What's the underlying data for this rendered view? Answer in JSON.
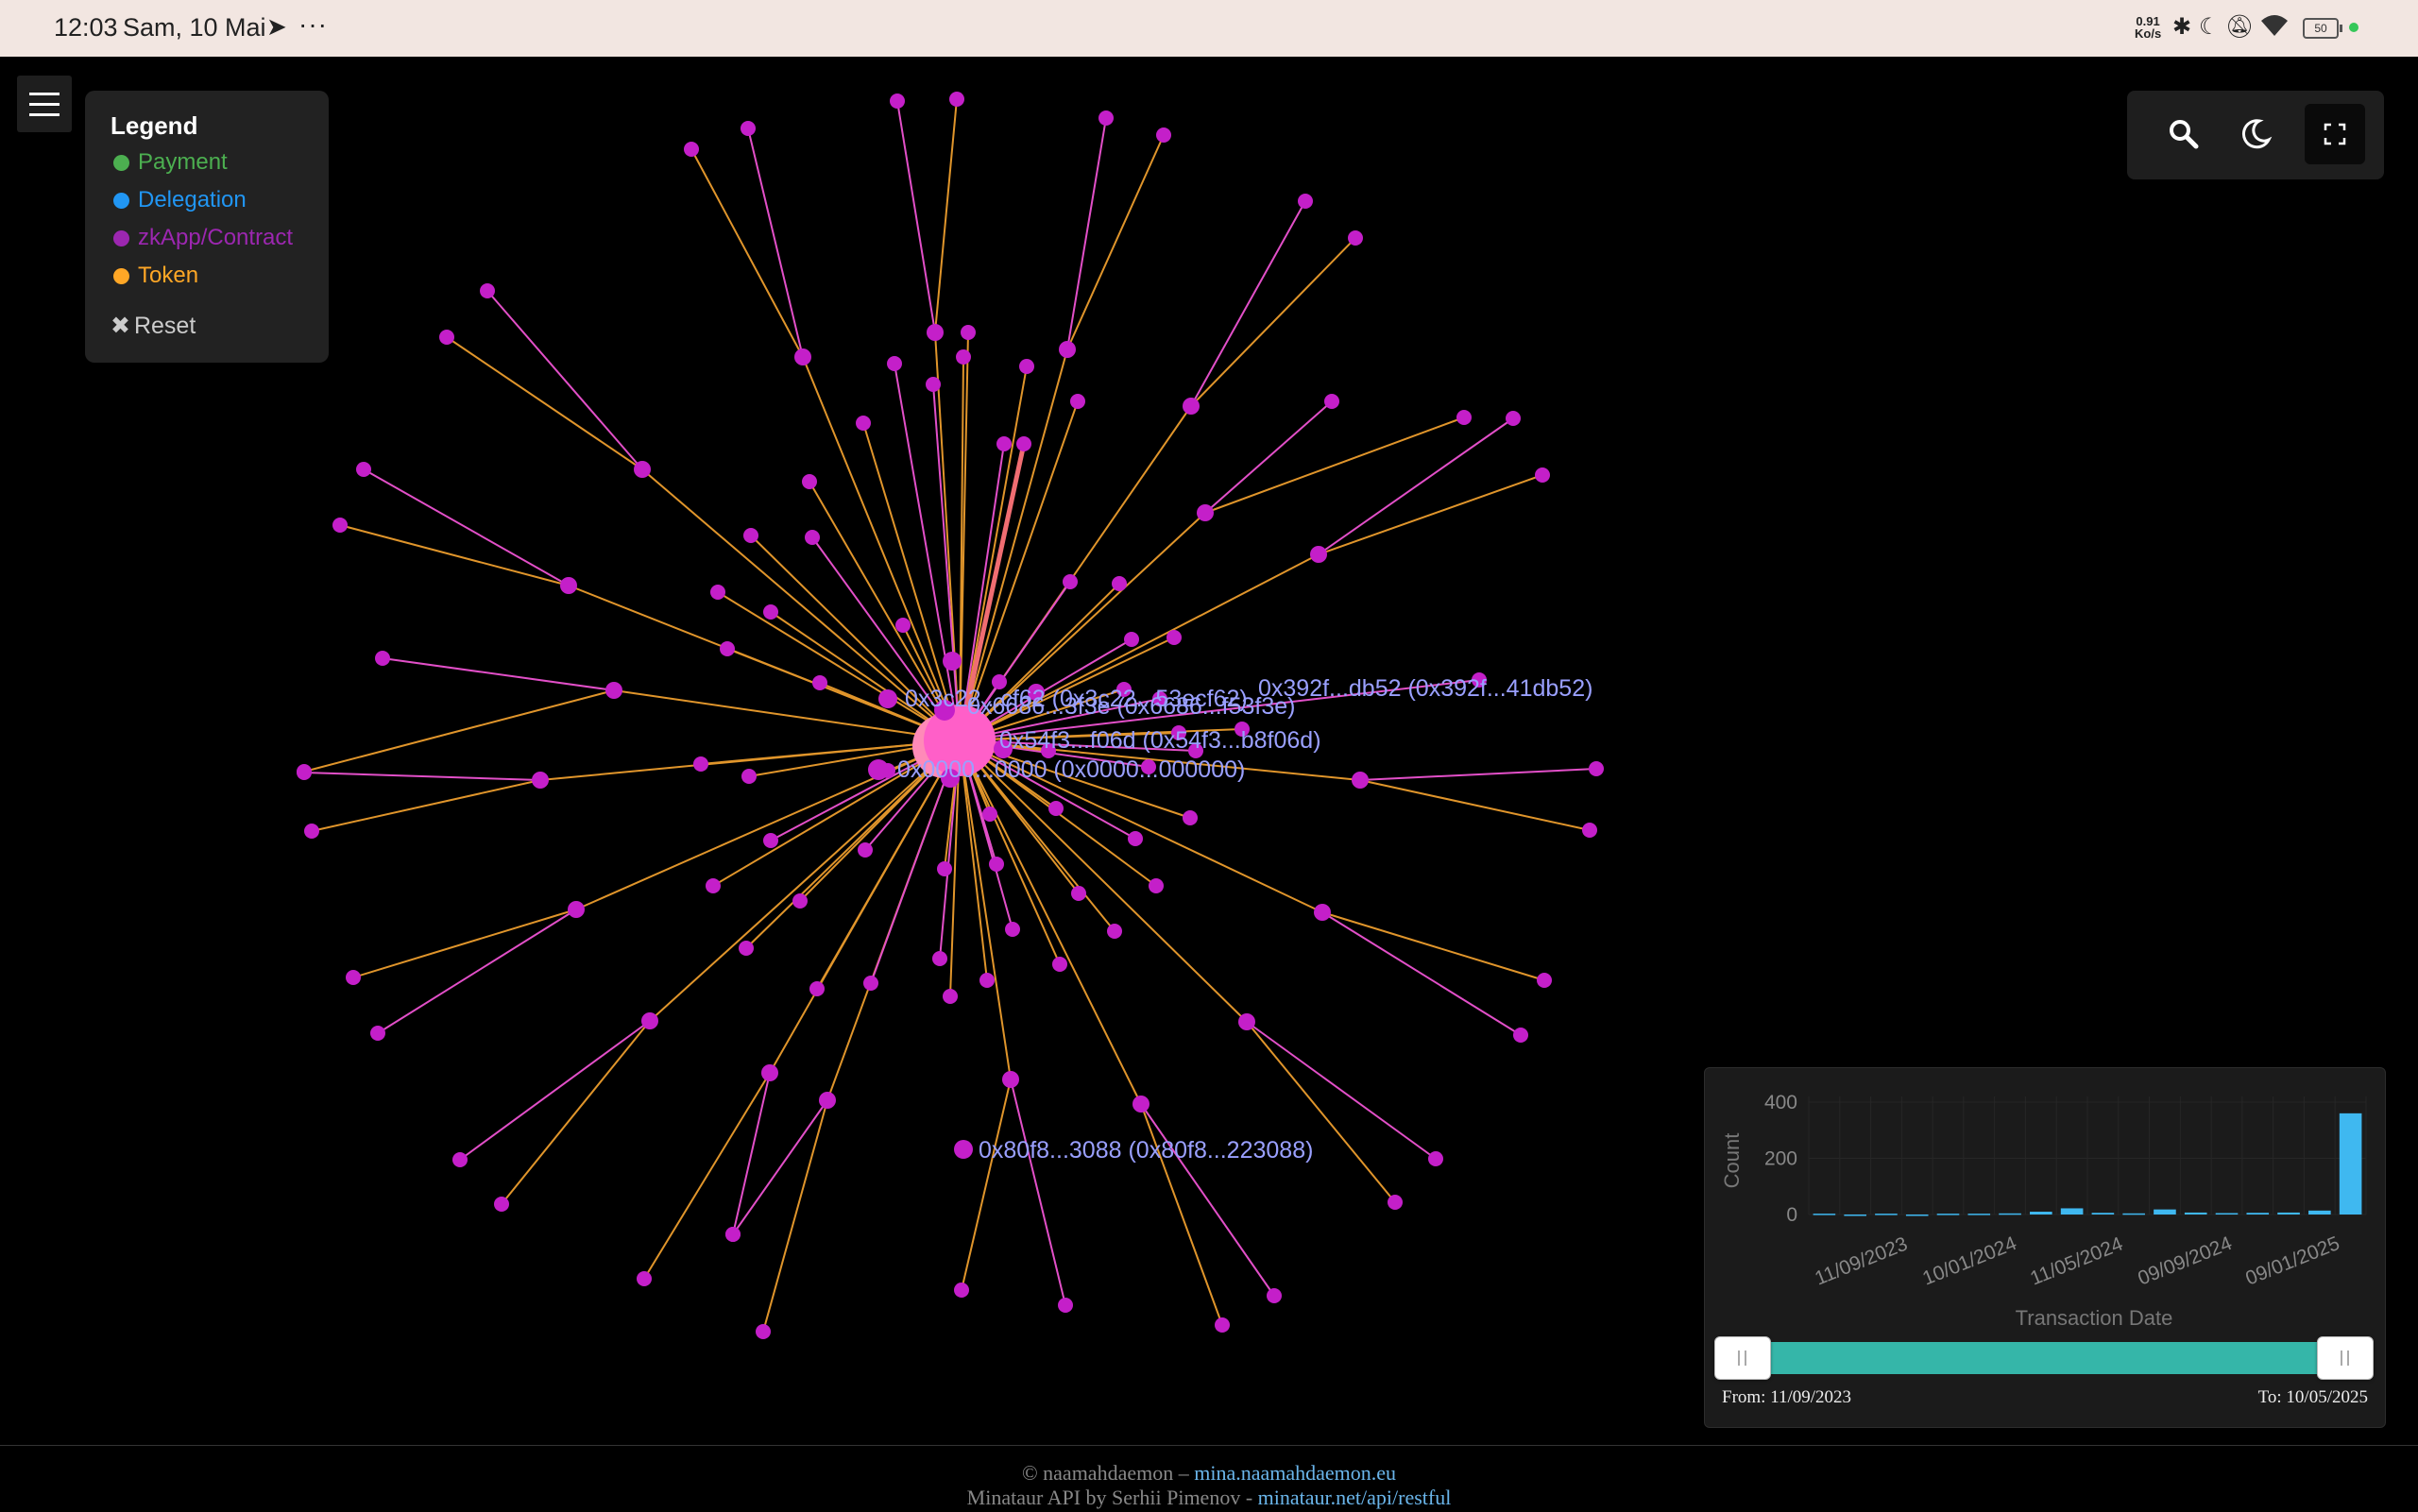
{
  "statusbar": {
    "time": "12:03",
    "date": "Sam, 10 Mai",
    "more": "···",
    "net_speed_value": "0.91",
    "net_speed_unit": "Ko/s",
    "battery": "50"
  },
  "legend": {
    "title": "Legend",
    "items": [
      {
        "label": "Payment",
        "color": "#4caf50"
      },
      {
        "label": "Delegation",
        "color": "#2196f3"
      },
      {
        "label": "zkApp/Contract",
        "color": "#9c27b0"
      },
      {
        "label": "Token",
        "color": "#ffa726"
      }
    ],
    "reset_label": "Reset"
  },
  "controls": {
    "icons": [
      "search-icon",
      "moon-icon",
      "fullscreen-icon"
    ]
  },
  "graph": {
    "node_color": "#c41fc9",
    "hub_color": "#ff5fc8",
    "labels": [
      "0x3c22...cf62 (0x3c22...53ecf62)",
      "0x6686...3f3e (0x6686...f53f3e)",
      "0x392f...db52 (0x392f...41db52)",
      "0x54f3...f06d (0x54f3...b8f06d)",
      "0x0000...0000 (0x0000...000000)",
      "0x80f8...3088 (0x80f8...223088)"
    ]
  },
  "histogram": {
    "chart_data": {
      "type": "bar",
      "ylabel": "Count",
      "xlabel": "Transaction Date",
      "yticks": [
        0,
        200,
        400
      ],
      "ylim": [
        0,
        420
      ],
      "xtick_labels": [
        "11/09/2023",
        "10/01/2024",
        "11/05/2024",
        "09/09/2024",
        "09/01/2025"
      ],
      "values": [
        3,
        0,
        3,
        0,
        3,
        3,
        4,
        10,
        22,
        6,
        4,
        18,
        7,
        5,
        6,
        7,
        14,
        360
      ],
      "bar_color": "#3fb8f0",
      "grid": true
    },
    "from_label": "From: 11/09/2023",
    "to_label": "To: 10/05/2025"
  },
  "footer": {
    "line1_prefix": "© naamahdaemon – ",
    "line1_link": "mina.naamahdaemon.eu",
    "line2_prefix": "Minataur API by Serhii Pimenov - ",
    "line2_link": "minataur.net/api/restful"
  }
}
